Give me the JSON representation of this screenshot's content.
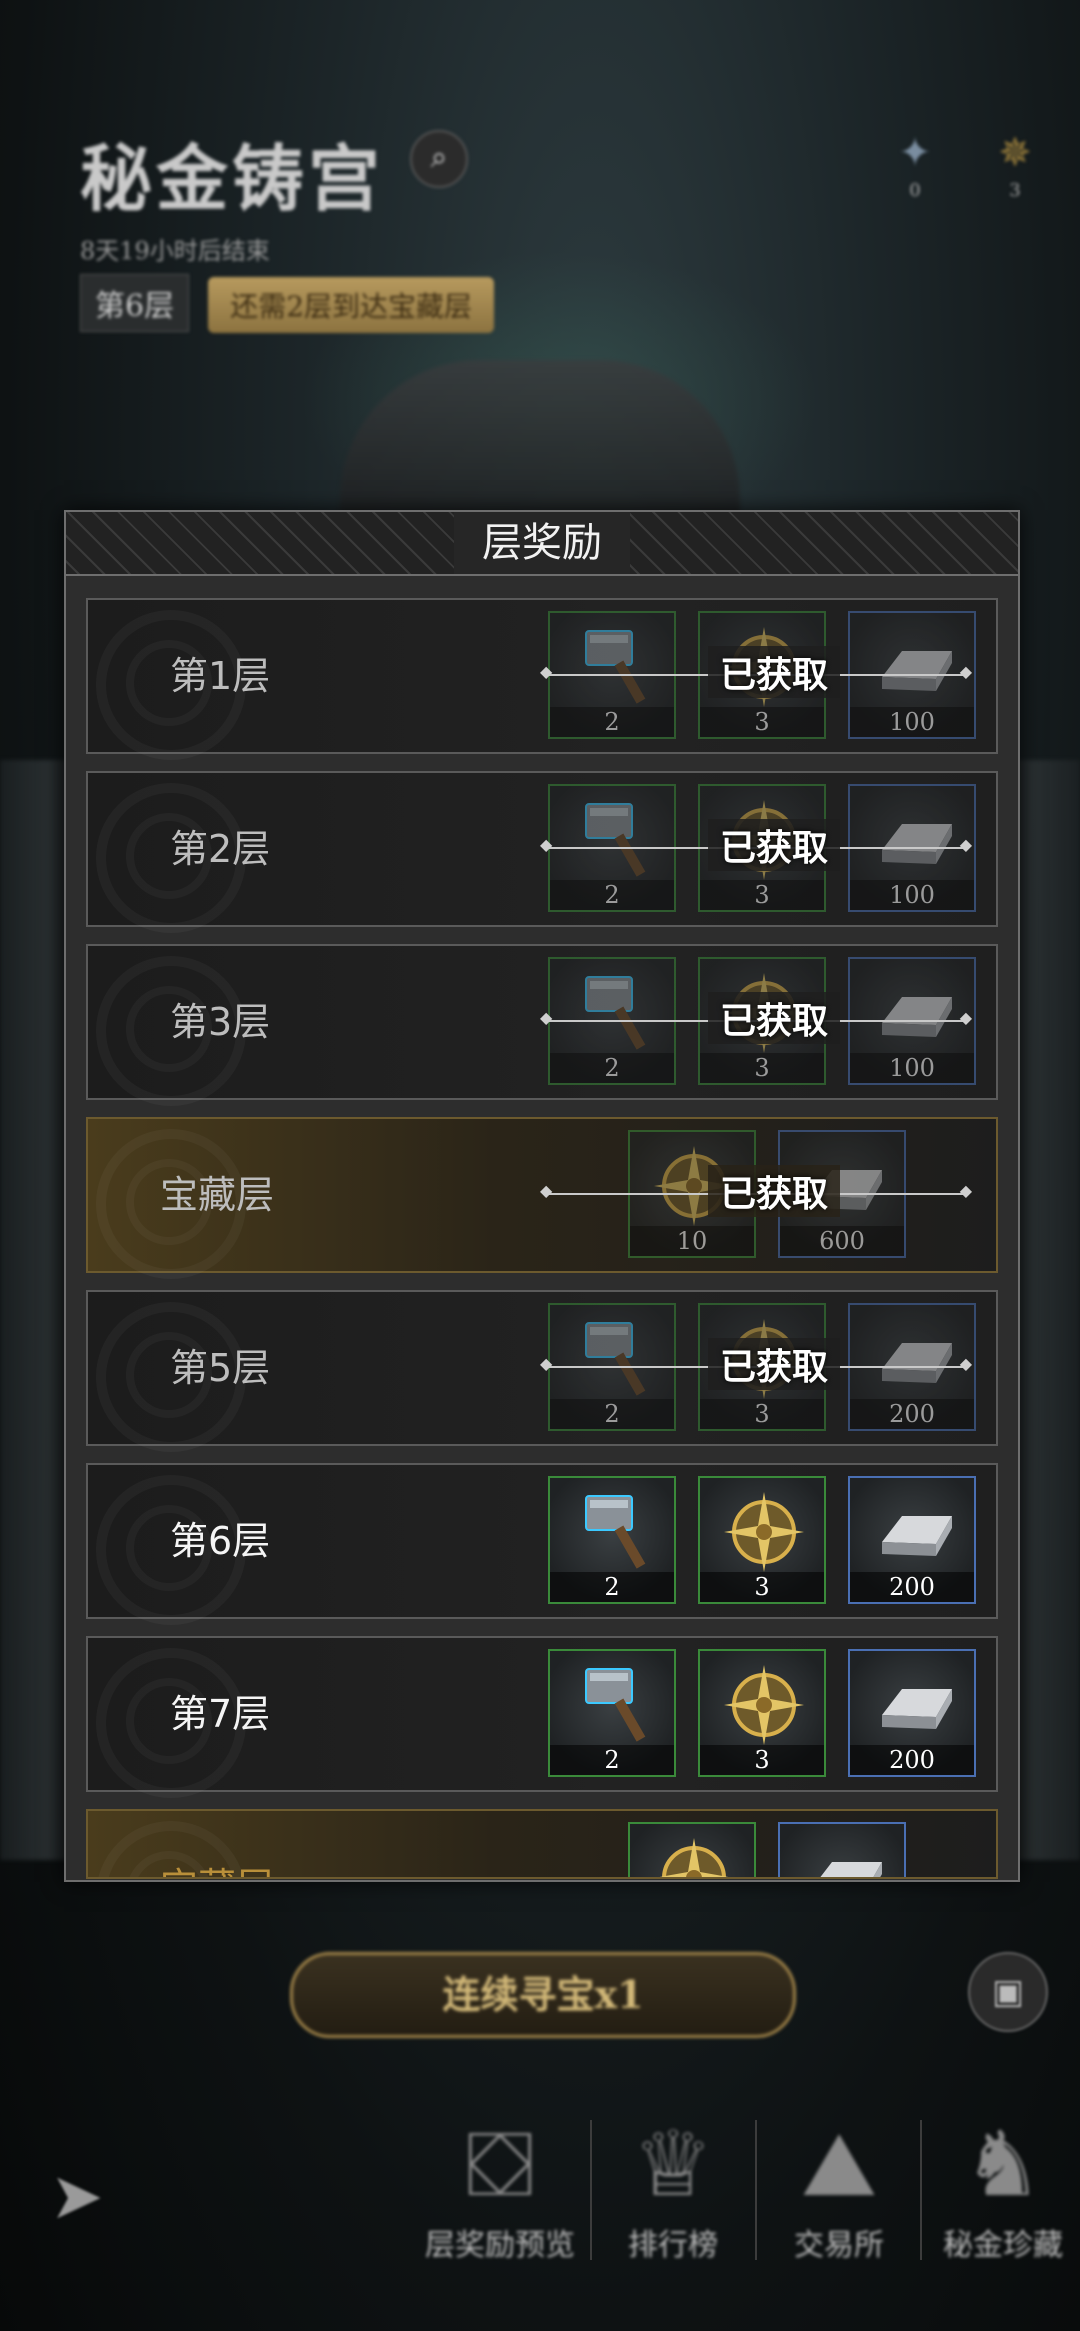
{
  "header": {
    "title": "秘金铸宫",
    "subtitle": "8天19小时后结束",
    "current_floor": "第6层",
    "hint": "还需2层到达宝藏层",
    "currencies": [
      {
        "icon": "blue-crystal-icon",
        "value": "0"
      },
      {
        "icon": "gold-compass-icon",
        "value": "3"
      }
    ]
  },
  "panel": {
    "title": "层奖励",
    "claimed_label": "已获取",
    "rows": [
      {
        "label": "第1层",
        "type": "normal",
        "claimed": true,
        "items": [
          {
            "icon": "hammer-icon",
            "count": "2",
            "rarity": "green"
          },
          {
            "icon": "compass-icon",
            "count": "3",
            "rarity": "green"
          },
          {
            "icon": "silver-ingot-icon",
            "count": "100",
            "rarity": "blue"
          }
        ]
      },
      {
        "label": "第2层",
        "type": "normal",
        "claimed": true,
        "items": [
          {
            "icon": "hammer-icon",
            "count": "2",
            "rarity": "green"
          },
          {
            "icon": "compass-icon",
            "count": "3",
            "rarity": "green"
          },
          {
            "icon": "silver-ingot-icon",
            "count": "100",
            "rarity": "blue"
          }
        ]
      },
      {
        "label": "第3层",
        "type": "normal",
        "claimed": true,
        "items": [
          {
            "icon": "hammer-icon",
            "count": "2",
            "rarity": "green"
          },
          {
            "icon": "compass-icon",
            "count": "3",
            "rarity": "green"
          },
          {
            "icon": "silver-ingot-icon",
            "count": "100",
            "rarity": "blue"
          }
        ]
      },
      {
        "label": "宝藏层",
        "type": "treasure",
        "claimed": true,
        "items": [
          {
            "icon": "compass-icon",
            "count": "10",
            "rarity": "green"
          },
          {
            "icon": "silver-ingot-icon",
            "count": "600",
            "rarity": "blue"
          }
        ]
      },
      {
        "label": "第5层",
        "type": "normal",
        "claimed": true,
        "items": [
          {
            "icon": "hammer-icon",
            "count": "2",
            "rarity": "green"
          },
          {
            "icon": "compass-icon",
            "count": "3",
            "rarity": "green"
          },
          {
            "icon": "silver-ingot-icon",
            "count": "200",
            "rarity": "blue"
          }
        ]
      },
      {
        "label": "第6层",
        "type": "normal",
        "claimed": false,
        "items": [
          {
            "icon": "hammer-icon",
            "count": "2",
            "rarity": "green"
          },
          {
            "icon": "compass-icon",
            "count": "3",
            "rarity": "green"
          },
          {
            "icon": "silver-ingot-icon",
            "count": "200",
            "rarity": "blue"
          }
        ]
      },
      {
        "label": "第7层",
        "type": "normal",
        "claimed": false,
        "items": [
          {
            "icon": "hammer-icon",
            "count": "2",
            "rarity": "green"
          },
          {
            "icon": "compass-icon",
            "count": "3",
            "rarity": "green"
          },
          {
            "icon": "silver-ingot-icon",
            "count": "200",
            "rarity": "blue"
          }
        ]
      },
      {
        "label": "宝藏层",
        "type": "treasure",
        "claimed": false,
        "partial": true,
        "items": [
          {
            "icon": "compass-icon",
            "count": "",
            "rarity": "green"
          },
          {
            "icon": "silver-ingot-icon",
            "count": "",
            "rarity": "blue"
          }
        ]
      }
    ]
  },
  "actions": {
    "continuous_hunt": "连续寻宝x1"
  },
  "nav": {
    "items": [
      {
        "label": "层奖励预览",
        "icon": "treasure-chest-icon"
      },
      {
        "label": "排行榜",
        "icon": "trophy-icon"
      },
      {
        "label": "交易所",
        "icon": "gold-pile-icon"
      },
      {
        "label": "秘金珍藏",
        "icon": "collection-icon"
      }
    ]
  },
  "colors": {
    "claimed_text": "#ffffff",
    "treasure_label": "#b98f3a",
    "rarity_green": "#3a8a3a",
    "rarity_blue": "#4a6fb3"
  }
}
